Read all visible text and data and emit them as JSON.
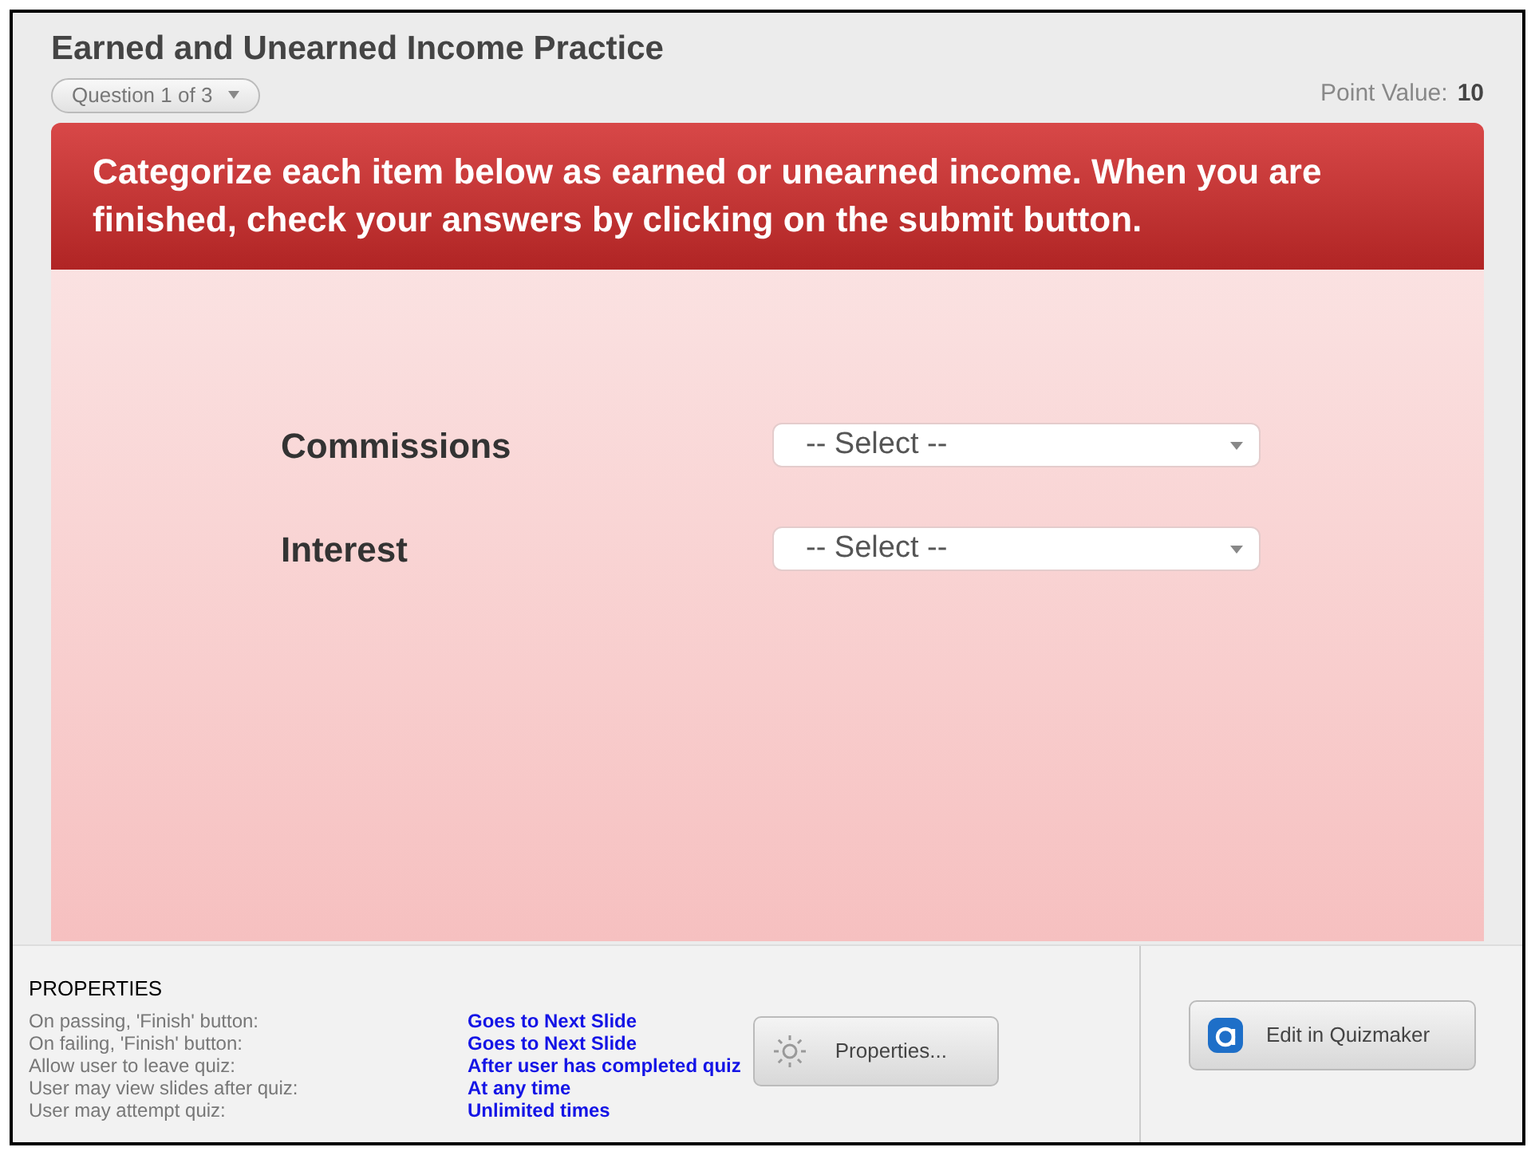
{
  "quiz": {
    "title": "Earned and Unearned Income Practice",
    "question_selector": "Question 1 of 3",
    "point_value_label": "Point Value:",
    "point_value": "10"
  },
  "question": {
    "prompt": "Categorize each item below as earned or unearned income.  When you are finished, check your answers by clicking on the submit button.",
    "items": [
      {
        "label": "Commissions",
        "placeholder": "-- Select --"
      },
      {
        "label": "Interest",
        "placeholder": "-- Select --"
      }
    ]
  },
  "properties": {
    "heading": "PROPERTIES",
    "rows": [
      {
        "label": "On passing, 'Finish' button:",
        "value": "Goes to Next Slide"
      },
      {
        "label": "On failing, 'Finish' button:",
        "value": "Goes to Next Slide"
      },
      {
        "label": "Allow user to leave quiz:",
        "value": "After user has completed quiz"
      },
      {
        "label": "User may view slides after quiz:",
        "value": "At any time"
      },
      {
        "label": "User may attempt quiz:",
        "value": "Unlimited times"
      }
    ],
    "properties_button": "Properties...",
    "edit_button": "Edit in Quizmaker"
  }
}
